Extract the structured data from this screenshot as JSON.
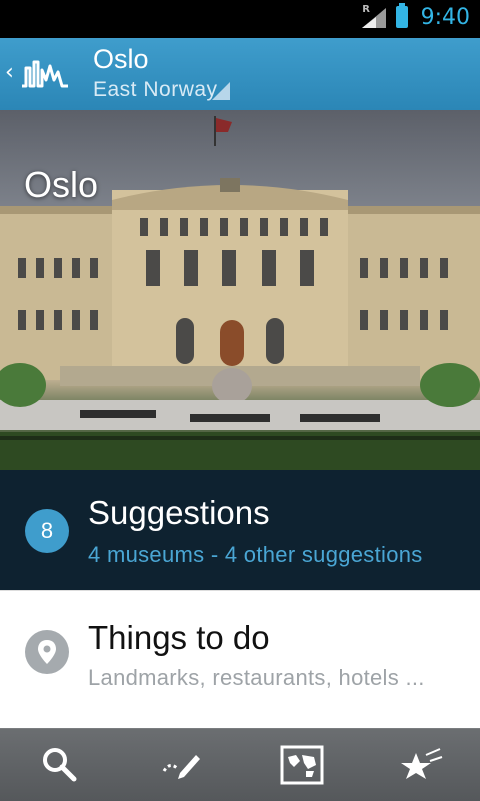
{
  "status": {
    "time": "9:40",
    "signal_label": "R"
  },
  "header": {
    "title": "Oslo",
    "subtitle": "East Norway"
  },
  "hero": {
    "title": "Oslo"
  },
  "list": {
    "suggestions": {
      "count": "8",
      "title": "Suggestions",
      "subtitle": "4 museums - 4 other suggestions"
    },
    "things": {
      "title": "Things to do",
      "subtitle": "Landmarks, restaurants, hotels ..."
    }
  },
  "bottom_nav": [
    {
      "icon": "search-icon"
    },
    {
      "icon": "edit-icon"
    },
    {
      "icon": "map-icon"
    },
    {
      "icon": "favorites-icon"
    }
  ],
  "colors": {
    "accent": "#3f9dcc",
    "dark_row": "#0e2230",
    "status_accent": "#33b5e5"
  }
}
